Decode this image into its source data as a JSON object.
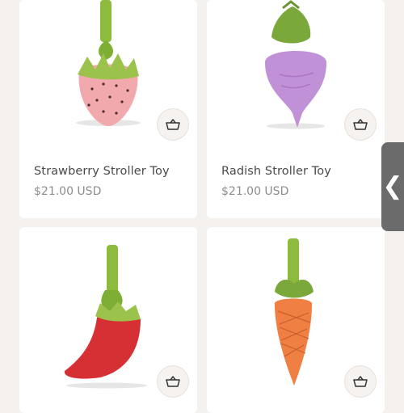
{
  "products": [
    {
      "title": "Strawberry Stroller Toy",
      "price": "$21.00 USD",
      "icon": "strawberry-toy"
    },
    {
      "title": "Radish Stroller Toy",
      "price": "$21.00 USD",
      "icon": "radish-toy"
    },
    {
      "title": "",
      "price": "",
      "icon": "chili-pepper-toy"
    },
    {
      "title": "",
      "price": "",
      "icon": "carrot-toy"
    }
  ],
  "side_tab": {
    "glyph": "❮"
  },
  "colors": {
    "background": "#f4f1ee",
    "card": "#ffffff",
    "side_tab": "#6b6b6b",
    "text": "#4a4a4a",
    "price": "#8c8c8c"
  }
}
